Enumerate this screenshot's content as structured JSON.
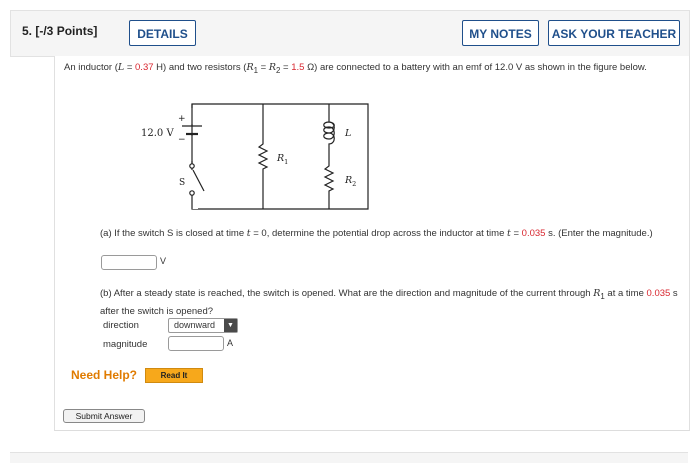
{
  "header": {
    "question_number": "5.",
    "points": "[-/3 Points]",
    "details_label": "DETAILS",
    "notes_label": "MY NOTES",
    "ask_label": "ASK YOUR TEACHER"
  },
  "problem": {
    "t1": "An inductor (",
    "L_sym": "L",
    "eq1": " = ",
    "L_val": "0.37",
    "t2": " H) and two resistors (",
    "R_sym": "R",
    "sub1": "1",
    "eq2": " = ",
    "R2_sym": "R",
    "sub2": "2",
    "eq3": " = ",
    "R_val": "1.5",
    "t3": " Ω) are connected to a battery with an emf of 12.0 V as shown in the figure below."
  },
  "circuit": {
    "battery_label": "12.0 V",
    "plus": "+",
    "minus": "−",
    "switch_label": "S",
    "r1_label": "R",
    "r1_sub": "1",
    "l_label": "L",
    "r2_label": "R",
    "r2_sub": "2"
  },
  "part_a": {
    "t1": "(a) If the switch S is closed at time ",
    "t_sym": "t",
    "t2": " = 0, determine the potential drop across the inductor at time ",
    "t_sym2": "t",
    "t3": " = ",
    "time_val": "0.035",
    "t4": " s. (Enter the magnitude.)",
    "input_value": "",
    "unit": "V"
  },
  "part_b": {
    "t1": "(b) After a steady state is reached, the switch is opened. What are the direction and magnitude of the current through ",
    "r_sym": "R",
    "r_sub": "1",
    "t2": " at a time ",
    "time_val": "0.035",
    "t3": " s after the switch is opened?",
    "direction_label": "direction",
    "direction_value": "downward",
    "magnitude_label": "magnitude",
    "magnitude_value": "",
    "unit": "A"
  },
  "help": {
    "need_help": "Need Help?",
    "read_it": "Read It"
  },
  "submit_label": "Submit Answer"
}
